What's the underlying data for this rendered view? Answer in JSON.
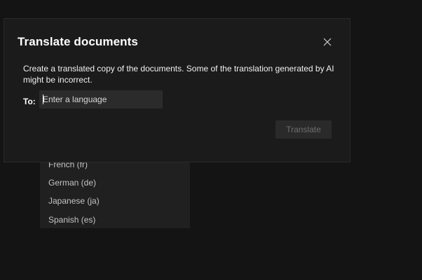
{
  "dialog": {
    "title": "Translate documents",
    "description": "Create a translated copy of the documents. Some of the translation generated by AI might be incorrect.",
    "to_label": "To:",
    "input_placeholder": "Enter a language",
    "input_value": "",
    "translate_label": "Translate",
    "translate_disabled": true,
    "close_icon": "close-icon"
  },
  "dropdown": {
    "items": [
      {
        "label": "French (fr)"
      },
      {
        "label": "German (de)"
      },
      {
        "label": "Japanese (ja)"
      },
      {
        "label": "Spanish (es)"
      }
    ]
  },
  "colors": {
    "background": "#141414",
    "dialog_background": "#1b1b1b",
    "input_background": "#2b2b2b",
    "dropdown_background": "#202020",
    "disabled_text": "#6e6e6e"
  }
}
